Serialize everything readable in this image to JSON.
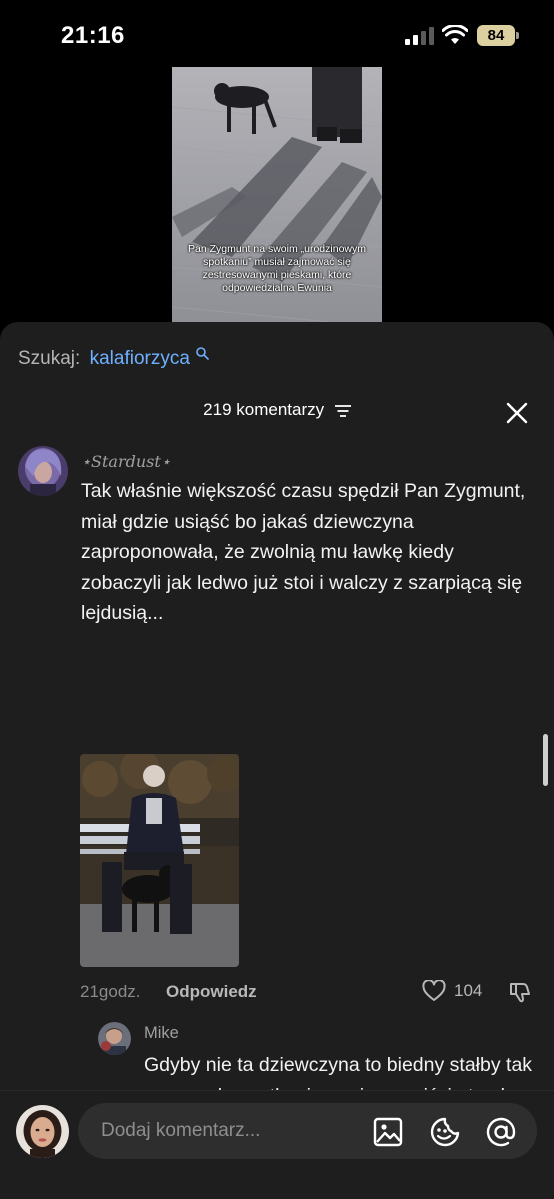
{
  "status_bar": {
    "time": "21:16",
    "battery": "84"
  },
  "video": {
    "caption": "Pan Zygmunt na swoim „urodzinowym spotkaniu” musiał zajmować się zestresowanymi pieskami, które odpowiedzialna Ewunia"
  },
  "search": {
    "label": "Szukaj:",
    "term": "kalafiorzyca"
  },
  "header": {
    "count_label": "219 komentarzy"
  },
  "comment": {
    "author": "⋆Stardust⋆",
    "text": "Tak właśnie większość czasu spędził Pan Zygmunt, miał gdzie usiąść bo jakaś dziewczyna zaproponowała, że zwolnią mu ławkę kiedy zobaczyli jak ledwo już stoi i walczy z szarpiącą się lejdusią...",
    "time": "21godz.",
    "reply_label": "Odpowiedz",
    "likes": "104"
  },
  "reply": {
    "author": "Mike",
    "text": "Gdyby nie ta dziewczyna to biedny stałby tak przez całe spotkanie, no i oczywiście trzeba pochwalić chłopaka z budki z lodami - to pan Zygmunt zapamiętał najlepiej z tego spotkania, darmowe, urodzinowe lody, a nie"
  },
  "input": {
    "placeholder": "Dodaj komentarz..."
  },
  "colors": {
    "accent": "#6fb0ff",
    "sheet": "#1e1e1e",
    "field": "#2e2e2e",
    "battery": "#ddd0a0"
  }
}
